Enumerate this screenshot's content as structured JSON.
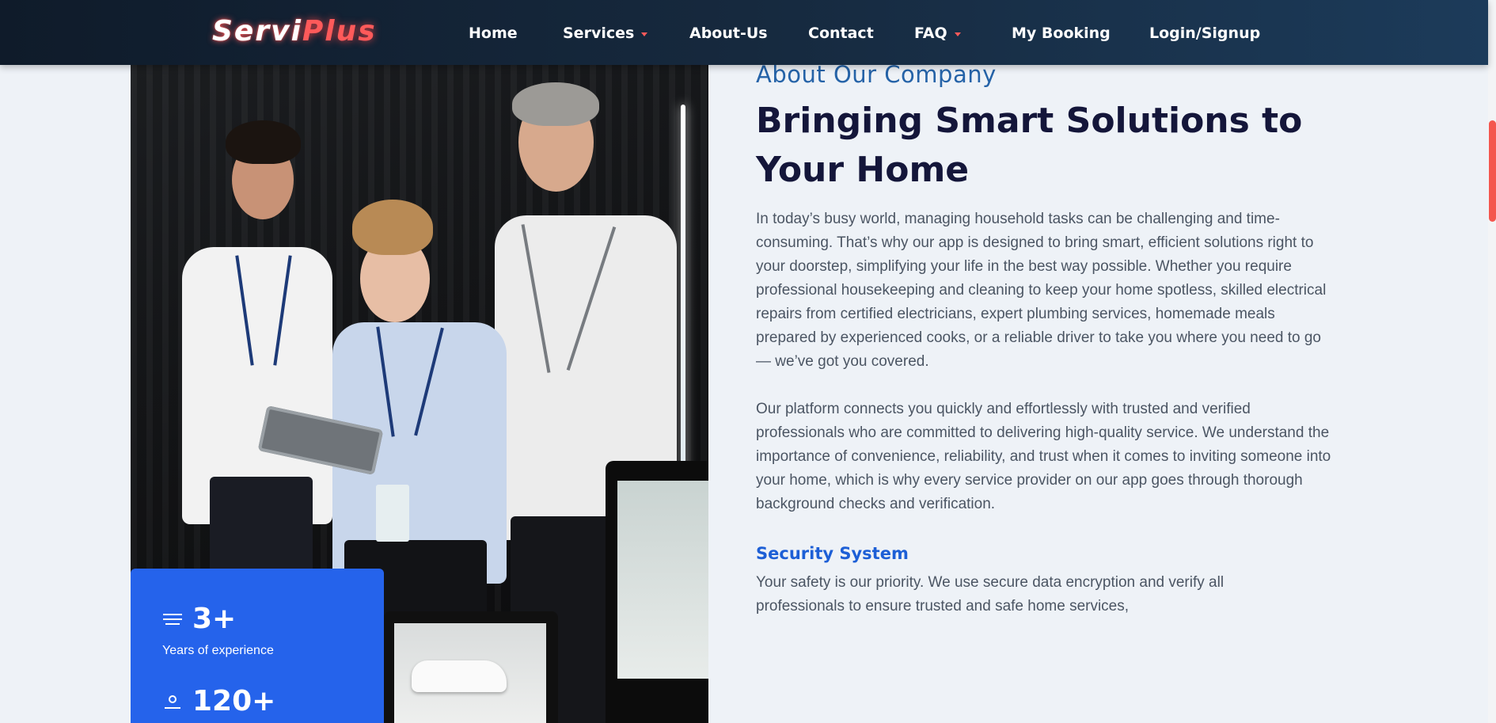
{
  "nav": {
    "logo_part1": "Servi",
    "logo_part2": "Plus",
    "items": [
      {
        "label": "Home",
        "dropdown": false
      },
      {
        "label": "Services",
        "dropdown": true
      },
      {
        "label": "About-Us",
        "dropdown": false
      },
      {
        "label": "Contact",
        "dropdown": false
      },
      {
        "label": "FAQ",
        "dropdown": true
      },
      {
        "label": "My Booking",
        "dropdown": false
      },
      {
        "label": "Login/Signup",
        "dropdown": false
      }
    ]
  },
  "about": {
    "eyebrow": "About Our Company",
    "headline_line1": "Bringing Smart Solutions to",
    "headline_line2": "Your Home",
    "paragraph1": "In today’s busy world, managing household tasks can be challenging and time-consuming. That’s why our app is designed to bring smart, efficient solutions right to your doorstep, simplifying your life in the best way possible. Whether you require professional housekeeping and cleaning to keep your home spotless, skilled electrical repairs from certified electricians, expert plumbing services, homemade meals prepared by experienced cooks, or a reliable driver to take you where you need to go — we’ve got you covered.",
    "paragraph2": "Our platform connects you quickly and effortlessly with trusted and verified professionals who are committed to delivering high-quality service. We understand the importance of convenience, reliability, and trust when it comes to inviting someone into your home, which is why every service provider on our app goes through thorough background checks and verification.",
    "section_title": "Security System",
    "section_text": "Your safety is our priority. We use secure data encryption and verify all professionals to ensure trusted and safe home services,"
  },
  "stats": [
    {
      "value": "3+",
      "label": "Years of experience",
      "icon": "menu-lines-icon"
    },
    {
      "value": "120+",
      "label": "",
      "icon": "user-icon"
    }
  ],
  "colors": {
    "accent_red": "#ff5a5a",
    "stat_card_blue": "#2563eb",
    "headline_navy": "#14163a",
    "section_title_blue": "#1d5fd6"
  },
  "scrollbar": {
    "thumb_color": "#f4564e"
  }
}
